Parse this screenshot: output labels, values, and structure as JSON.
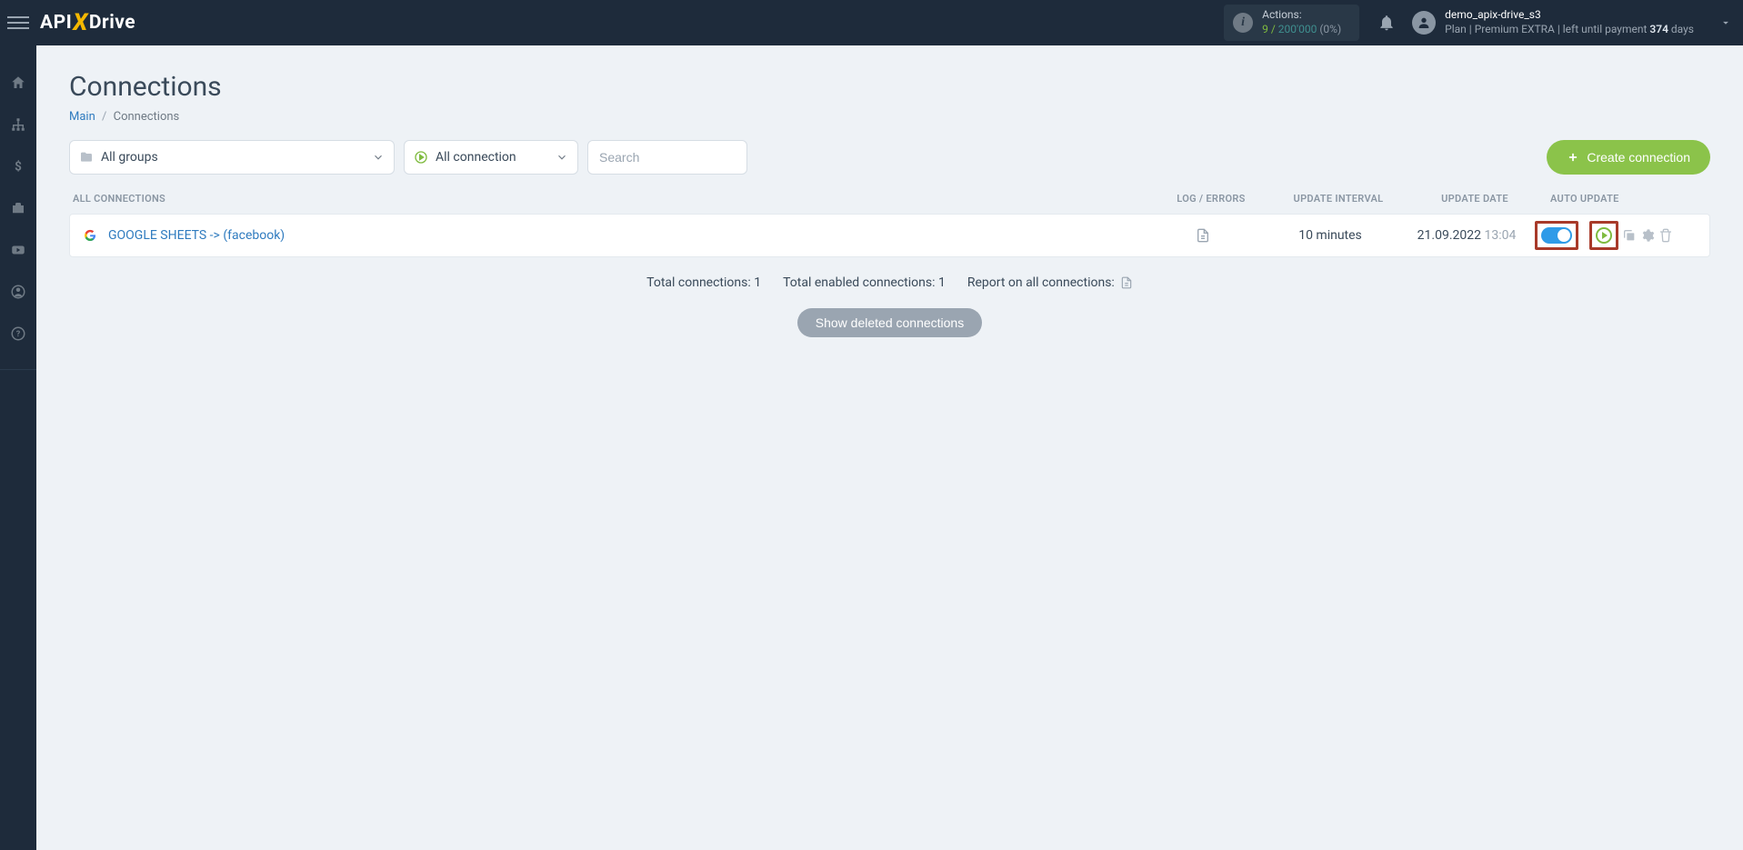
{
  "header": {
    "logo": {
      "part1": "API",
      "part2": "X",
      "part3": "Drive"
    },
    "actions": {
      "label": "Actions:",
      "count": "9",
      "sep": " / ",
      "limit": "200'000",
      "pct": "(0%)"
    },
    "user": {
      "name": "demo_apix-drive_s3",
      "plan_prefix": "Plan ",
      "plan_sep1": "| ",
      "plan_name": "Premium EXTRA ",
      "plan_sep2": "| ",
      "plan_mid": "left until payment ",
      "plan_days": "374",
      "plan_suffix": " days"
    }
  },
  "page": {
    "title": "Connections",
    "breadcrumb": {
      "main": "Main",
      "sep": "/",
      "current": "Connections"
    }
  },
  "toolbar": {
    "groups_label": "All groups",
    "conn_label": "All connection",
    "search_placeholder": "Search",
    "create_label": "Create connection"
  },
  "table": {
    "header": {
      "name": "ALL CONNECTIONS",
      "log": "LOG / ERRORS",
      "interval": "UPDATE INTERVAL",
      "date": "UPDATE DATE",
      "auto": "AUTO UPDATE"
    },
    "rows": [
      {
        "name": "GOOGLE SHEETS -> (facebook)",
        "interval": "10 minutes",
        "date": "21.09.2022",
        "time": "13:04"
      }
    ]
  },
  "summary": {
    "total": "Total connections: 1",
    "enabled": "Total enabled connections: 1",
    "report": "Report on all connections:"
  },
  "deleted_btn": "Show deleted connections"
}
